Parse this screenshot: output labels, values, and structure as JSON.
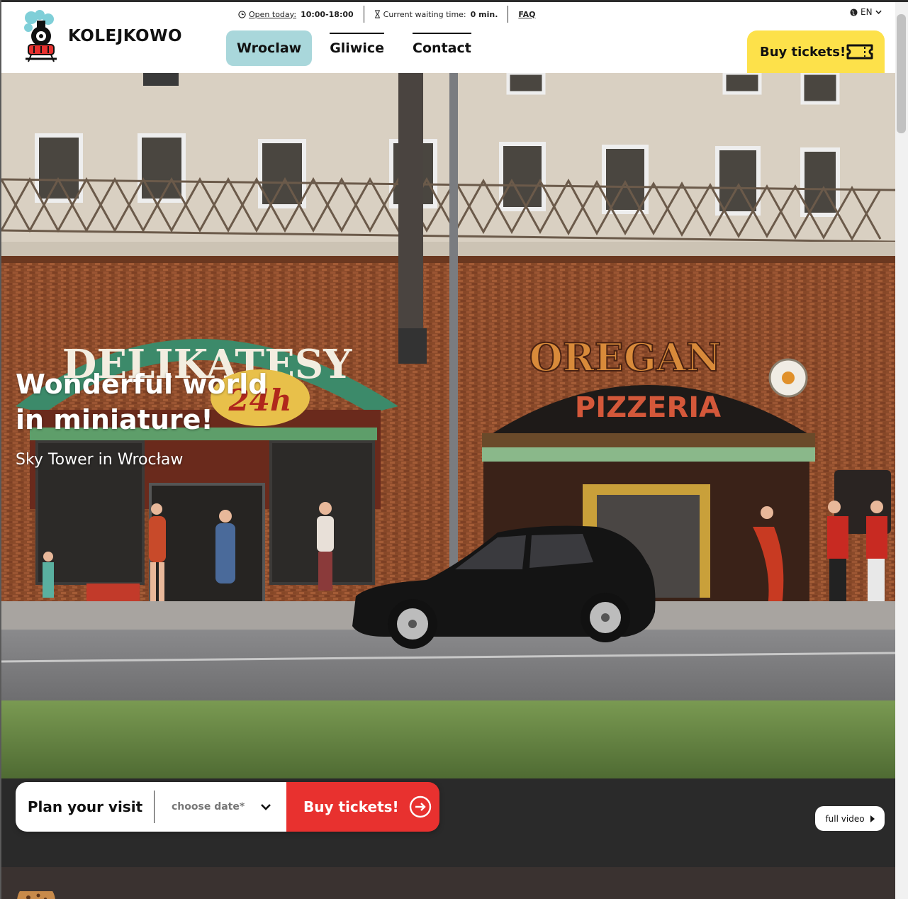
{
  "topbar": {
    "open_label": "Open today:",
    "open_hours": "10:00-18:00",
    "waiting_label": "Current waiting time:",
    "waiting_value": "0 min.",
    "faq": "FAQ"
  },
  "language": "EN",
  "logo": {
    "text": "KOLEJKOWO"
  },
  "nav": [
    {
      "label": "Wroclaw",
      "active": true
    },
    {
      "label": "Gliwice",
      "active": false
    },
    {
      "label": "Contact",
      "active": false
    }
  ],
  "buy_tickets_header": "Buy tickets!",
  "hero": {
    "title_line1": "Wonderful world",
    "title_line2": "in miniature!",
    "subtitle": "Sky Tower in Wrocław"
  },
  "scene_signs": {
    "delikatesy": "DELIKATESY",
    "hours": "24h",
    "oregano": "OREGAN",
    "pizzeria": "PIZZERIA"
  },
  "plan": {
    "label": "Plan your visit",
    "date_placeholder": "choose date*",
    "buy": "Buy tickets!"
  },
  "full_video": "full video",
  "colors": {
    "accent_teal": "#a9d7db",
    "accent_yellow": "#fde14a",
    "accent_red": "#e8312f"
  }
}
